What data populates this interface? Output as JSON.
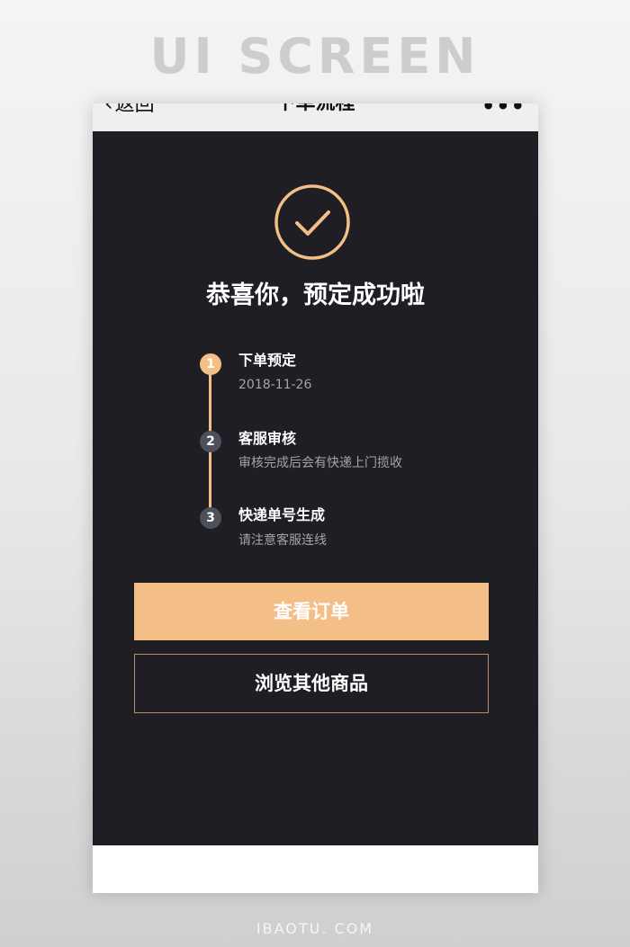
{
  "banner": {
    "title": "UI SCREEN"
  },
  "nav": {
    "back_label": "返回",
    "back_icon": "chevron-left-icon",
    "title": "下单流程",
    "more_icon": "more-dots-icon"
  },
  "success": {
    "icon": "check-circle-icon",
    "title": "恭喜你，预定成功啦"
  },
  "steps": [
    {
      "number": "1",
      "title": "下单预定",
      "desc": "2018-11-26",
      "status": "active"
    },
    {
      "number": "2",
      "title": "客服审核",
      "desc": "审核完成后会有快递上门揽收",
      "status": "pending"
    },
    {
      "number": "3",
      "title": "快递单号生成",
      "desc": "请注意客服连线",
      "status": "pending"
    }
  ],
  "buttons": {
    "primary": "查看订单",
    "secondary": "浏览其他商品"
  },
  "footer": {
    "text": "IBAOTU. COM"
  },
  "colors": {
    "accent": "#f3bf87",
    "background": "#1e1e24",
    "inactive_dot": "#4d5058",
    "muted_text": "#a3a5ab"
  }
}
